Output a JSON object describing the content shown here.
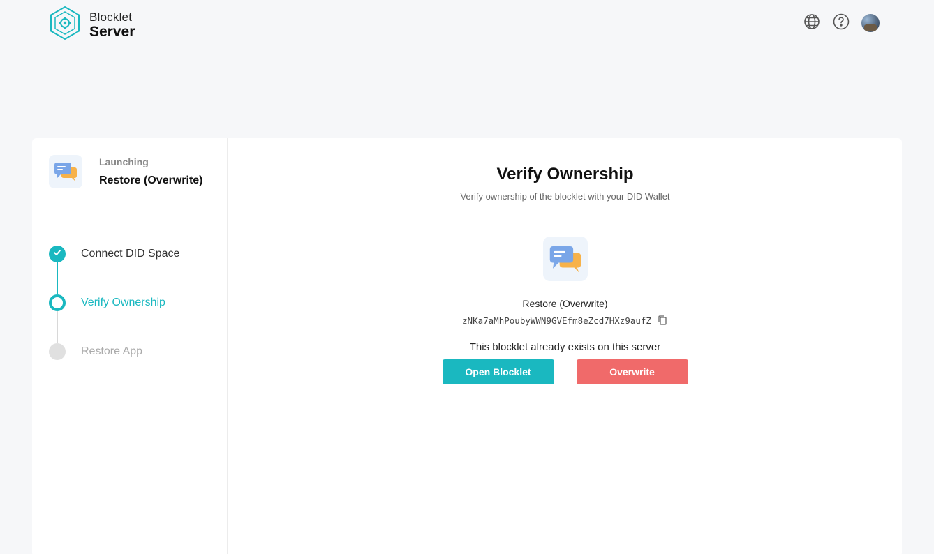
{
  "header": {
    "logo_line1": "Blocklet",
    "logo_line2": "Server",
    "icons": [
      "globe-icon",
      "help-icon",
      "avatar"
    ]
  },
  "sidebar": {
    "status": "Launching",
    "app_name": "Restore (Overwrite)",
    "steps": [
      {
        "label": "Connect DID Space",
        "state": "done"
      },
      {
        "label": "Verify Ownership",
        "state": "active"
      },
      {
        "label": "Restore App",
        "state": "todo"
      }
    ]
  },
  "main": {
    "title": "Verify Ownership",
    "subtitle": "Verify ownership of the blocklet with your DID Wallet",
    "blocklet_name": "Restore (Overwrite)",
    "did": "zNKa7aMhPoubyWWN9GVEfm8eZcd7HXz9aufZ",
    "exists_message": "This blocklet already exists on this server",
    "open_button": "Open Blocklet",
    "overwrite_button": "Overwrite"
  },
  "colors": {
    "accent": "#1ab8c0",
    "danger": "#f06a6a",
    "background": "#f6f7f9"
  }
}
